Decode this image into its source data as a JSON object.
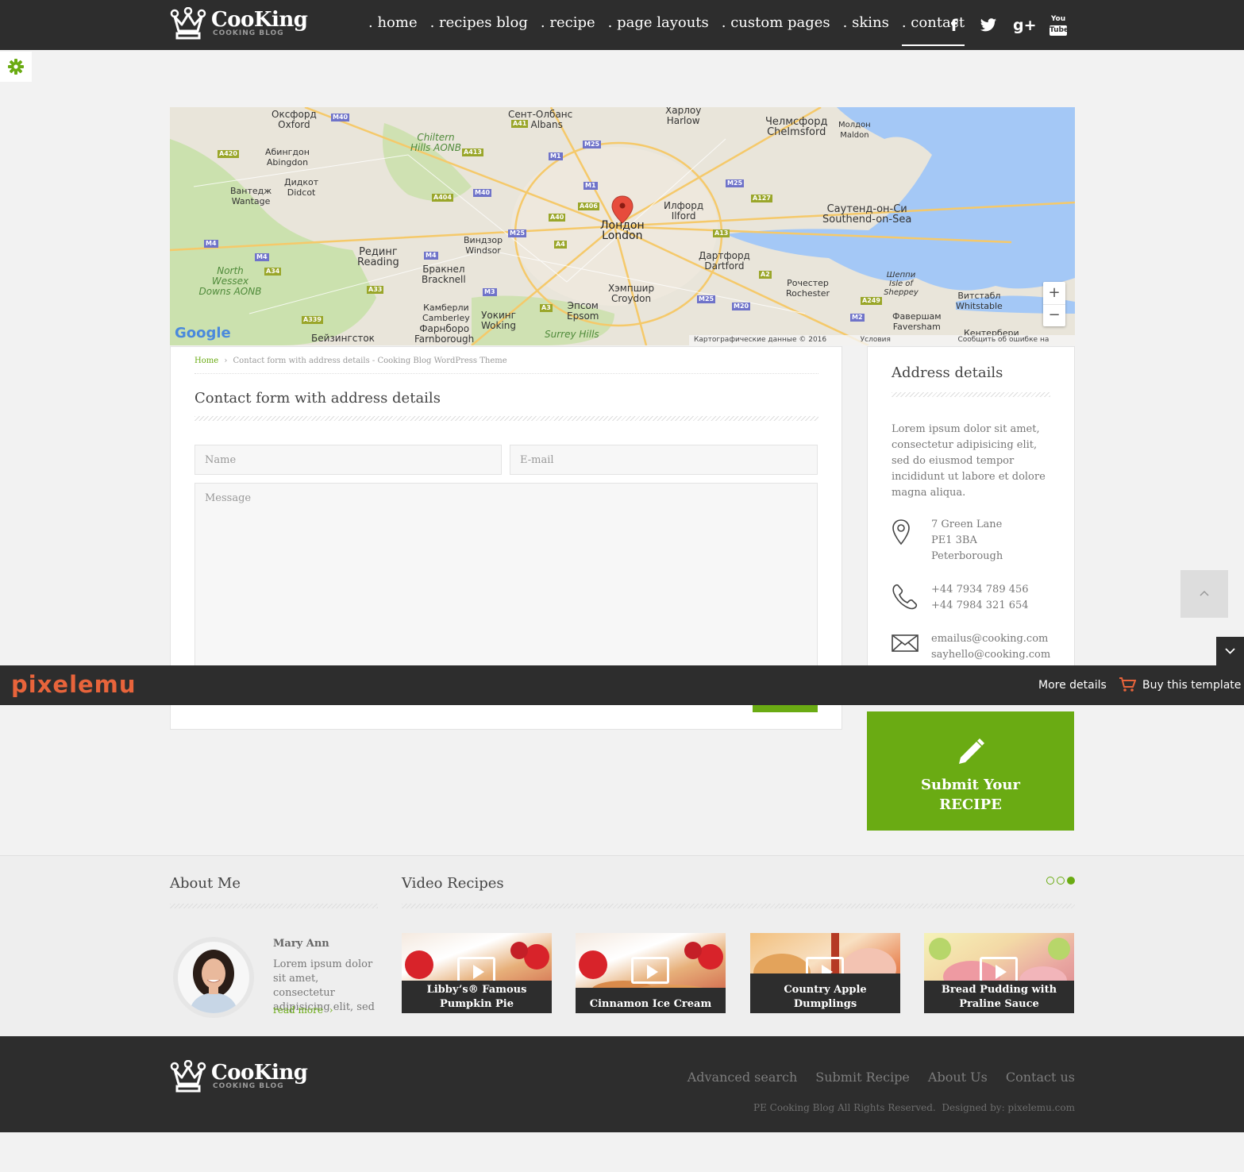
{
  "header": {
    "logo": {
      "name": "CooKing",
      "tagline": "COOKING BLOG"
    },
    "nav": [
      ". home",
      ". recipes blog",
      ". recipe",
      ". page layouts",
      ". custom pages",
      ". skins",
      ". contact"
    ],
    "social": {
      "facebook": "f",
      "twitter": "twitter-icon",
      "googleplus": "g+",
      "youtube_top": "You",
      "youtube_bottom": "Tube"
    }
  },
  "map": {
    "labels": [
      {
        "ru": "Оксфорд",
        "en": "Oxford"
      },
      {
        "ru": "Сент-Олбанс",
        "en": "St Albans"
      },
      {
        "ru": "Харлоу",
        "en": "Harlow"
      },
      {
        "ru": "Челмсфорд",
        "en": "Chelmsford"
      },
      {
        "ru": "Молдон",
        "en": "Maldon"
      },
      {
        "ru": "Абингдон",
        "en": "Abingdon"
      },
      {
        "ru": "Вантедж",
        "en": "Wantage"
      },
      {
        "ru": "Дидкот",
        "en": "Didcot"
      },
      {
        "ru": "Лондон",
        "en": "London"
      },
      {
        "ru": "Илфорд",
        "en": "Ilford"
      },
      {
        "ru": "Саутенд-он-Си",
        "en": "Southend-on-Sea"
      },
      {
        "ru": "Виндзор",
        "en": "Windsor"
      },
      {
        "ru": "Рединг",
        "en": "Reading"
      },
      {
        "ru": "Бракнел",
        "en": "Bracknell"
      },
      {
        "ru": "Дартфорд",
        "en": "Dartford"
      },
      {
        "ru": "Рочестер",
        "en": "Rochester"
      },
      {
        "ru": "Шеппи",
        "en": "Isle of Sheppey"
      },
      {
        "ru": "Хэмпшир",
        "en": "Croydon"
      },
      {
        "ru": "Камберли",
        "en": "Camberley"
      },
      {
        "ru": "Уокинг",
        "en": "Woking"
      },
      {
        "ru": "Эпсом",
        "en": "Epsom"
      },
      {
        "ru": "Витстабл",
        "en": "Whitstable"
      },
      {
        "ru": "Фавершам",
        "en": "Faversham"
      },
      {
        "ru": "Фарнборо",
        "en": "Farnborough"
      },
      {
        "ru": "Бейзингсток",
        "en": ""
      },
      {
        "ru": "Кентербери",
        "en": ""
      }
    ],
    "areas": [
      "Chiltern Hills AONB",
      "North Wessex Downs AONB",
      "Surrey Hills"
    ],
    "roads": [
      "M40",
      "A41",
      "M25",
      "A420",
      "A413",
      "M1",
      "M40",
      "M1",
      "A404",
      "A406",
      "M25",
      "A127",
      "A40",
      "M4",
      "M4",
      "M4",
      "A34",
      "M25",
      "A4",
      "A13",
      "A2",
      "A33",
      "M3",
      "A3",
      "M25",
      "M20",
      "A249",
      "A339",
      "M2"
    ],
    "attribution": "Картографические данные © 2016 Google",
    "terms": "Условия использования",
    "report": "Сообщить об ошибке на карте",
    "google": "Google",
    "zoom_in": "+",
    "zoom_out": "−"
  },
  "breadcrumb": {
    "home": "Home",
    "separator": "›",
    "current": "Contact form with address details - Cooking Blog WordPress Theme"
  },
  "form": {
    "title": "Contact form with address details",
    "name_placeholder": "Name",
    "email_placeholder": "E-mail",
    "message_placeholder": "Message"
  },
  "address": {
    "title": "Address details",
    "text": "Lorem ipsum dolor sit amet, consectetur adipisicing elit, sed do eiusmod tempor incididunt ut labore et dolore magna aliqua.",
    "street": "7 Green Lane",
    "postcode": "PE1 3BA",
    "city": "Peterborough",
    "phone1": "+44 7934 789 456",
    "phone2": "+44 7984 321 654",
    "email1": "emailus@cooking.com",
    "email2": "sayhello@cooking.com"
  },
  "submit": {
    "line1": "Submit Your",
    "line2": "RECIPE"
  },
  "promo": {
    "brand": "pixelemu",
    "more": "More details",
    "buy": "Buy this template"
  },
  "about": {
    "title": "About Me",
    "name": "Mary Ann",
    "text": "Lorem ipsum dolor sit amet, consectetur adipisicing elit, sed",
    "more": "read more"
  },
  "videos": {
    "title": "Video Recipes",
    "items": [
      "Libby’s® Famous Pumpkin Pie",
      "Cinnamon Ice Cream",
      "Country Apple Dumplings",
      "Bread Pudding with Praline Sauce"
    ]
  },
  "footer": {
    "links": [
      "Advanced search",
      "Submit Recipe",
      "About Us",
      "Contact us"
    ],
    "copyright": "PE Cooking Blog All Rights Reserved.  Designed by: pixelemu.com"
  },
  "colors": {
    "accent": "#6aab13",
    "dark": "#2d2d2d",
    "water": "#9ec5f5"
  }
}
